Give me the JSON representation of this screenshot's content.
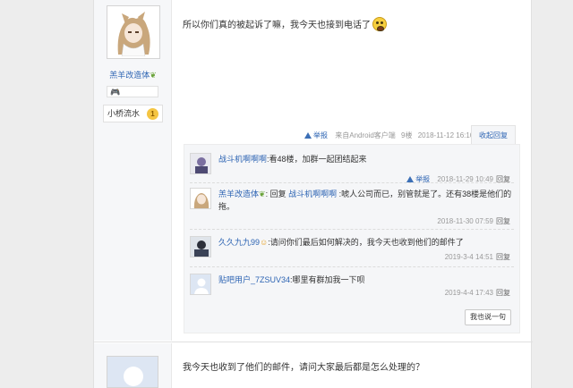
{
  "post1": {
    "author": {
      "name": "羔羊改造体",
      "level_name": "小桥流水",
      "level": "1"
    },
    "content": "所以你们真的被起诉了嘛，我今天也接到电话了",
    "emoji": "scared-face-emoji",
    "meta": {
      "report_label": "举报",
      "source": "来自Android客户端",
      "floor": "9楼",
      "time": "2018-11-12 16:10"
    },
    "fold_label": "收起回复"
  },
  "replies": [
    {
      "user": "战斗机啊啊啊",
      "text": ":看48楼，加群一起团结起来",
      "report_label": "举报",
      "time": "2018-11-29 10:49",
      "reply_label": "回复"
    },
    {
      "user": "羔羊改造体",
      "prefix": ": 回复 ",
      "target": "战斗机啊啊啊",
      "text": " :唬人公司而已，别管就是了。还有38楼是他们的拖。",
      "time": "2018-11-30 07:59",
      "reply_label": "回复"
    },
    {
      "user": "久久九九99",
      "text": ":请问你们最后如何解决的，我今天也收到他们的邮件了",
      "time": "2019-3-4 14:51",
      "reply_label": "回复"
    },
    {
      "user": "贴吧用户_7ZSUV34",
      "text": ":哪里有群加我一下呗",
      "time": "2019-4-4 17:43",
      "reply_label": "回复"
    }
  ],
  "say_button": "我也说一句",
  "post2": {
    "content": "我今天也收到了他们的邮件，请问大家最后都是怎么处理的？"
  },
  "colors": {
    "link": "#2d64b3",
    "muted": "#999999",
    "sidebar_bg": "#f6f7f9",
    "page_bg": "#ededed"
  }
}
